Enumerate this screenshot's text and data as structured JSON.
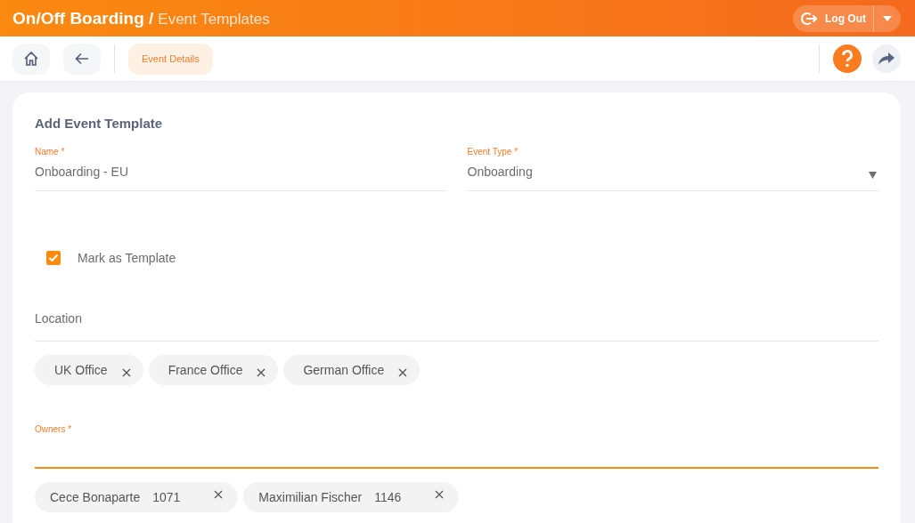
{
  "header": {
    "app_title": "On/Off Boarding /",
    "page_title": "Event Templates",
    "logout_button": "Log Out"
  },
  "toolbar": {
    "tabs": [
      {
        "label": "Event Details",
        "selected": true
      }
    ]
  },
  "form": {
    "title": "Add Event Template",
    "name_field": {
      "label": "Name *",
      "value": "Onboarding - EU"
    },
    "event_type_field": {
      "label": "Event Type *",
      "value": "Onboarding"
    },
    "mark_as_template": {
      "label": "Mark as Template",
      "checked": true
    },
    "location_field": {
      "placeholder": "Location",
      "focused": false,
      "chips": [
        {
          "label": "UK Office"
        },
        {
          "label": "France Office"
        },
        {
          "label": "German Office"
        }
      ]
    },
    "owners_field": {
      "label": "Owners *",
      "focused": true,
      "chips": [
        {
          "name": "Cece Bonaparte",
          "id": "1071"
        },
        {
          "name": "Maximilian Fischer",
          "id": "1146"
        }
      ]
    }
  }
}
